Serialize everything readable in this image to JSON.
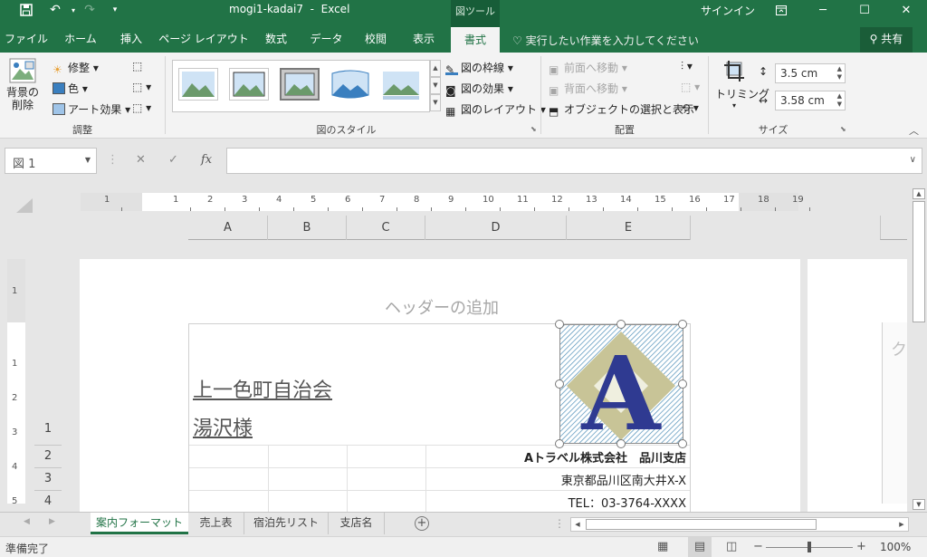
{
  "window": {
    "filename": "mogi1-kadai7",
    "separator": "-",
    "app": "Excel",
    "context_tab": "図ツール",
    "signin": "サインイン"
  },
  "tabs": [
    "ファイル",
    "ホーム",
    "挿入",
    "ページ レイアウト",
    "数式",
    "データ",
    "校閲",
    "表示",
    "書式"
  ],
  "tell_me": "実行したい作業を入力してください",
  "share": "共有",
  "ribbon": {
    "remove_bg": [
      "背景の",
      "削除"
    ],
    "adjust": {
      "corrections": "修整",
      "color": "色",
      "artistic": "アート効果",
      "group": "調整"
    },
    "styles": {
      "border": "図の枠線",
      "effects": "図の効果",
      "layout": "図のレイアウト",
      "group": "図のスタイル"
    },
    "arrange": {
      "bring_forward": "前面へ移動",
      "send_backward": "背面へ移動",
      "selection_pane": "オブジェクトの選択と表示",
      "group": "配置"
    },
    "size": {
      "crop": "トリミング",
      "height": "3.5 cm",
      "width": "3.58 cm",
      "group": "サイズ"
    }
  },
  "formula": {
    "namebox": "図 1",
    "fx": "fx",
    "cancel": "✕",
    "enter": "✓"
  },
  "ruler_labels": [
    "1",
    "1",
    "2",
    "3",
    "4",
    "5",
    "6",
    "7",
    "8",
    "9",
    "10",
    "11",
    "12",
    "13",
    "14",
    "15",
    "16",
    "17",
    "18",
    "19"
  ],
  "vruler_labels": [
    "1",
    "1",
    "2",
    "3",
    "4",
    "5"
  ],
  "columns": [
    "A",
    "B",
    "C",
    "D",
    "E"
  ],
  "rows": [
    "1",
    "2",
    "3",
    "4"
  ],
  "sheet": {
    "header_placeholder": "ヘッダーの追加",
    "a1_line1": "上一色町自治会",
    "a1_line2": "湯沢様",
    "e2": "Aトラベル株式会社　品川支店",
    "e3": "東京都品川区南大井X-X",
    "e4": "TEL：03-3764-XXXX",
    "next_page_text": "ク",
    "logo_letter": "A"
  },
  "sheet_tabs": [
    "案内フォーマット",
    "売上表",
    "宿泊先リスト",
    "支店名"
  ],
  "status": {
    "ready": "準備完了",
    "zoom": "100%"
  }
}
